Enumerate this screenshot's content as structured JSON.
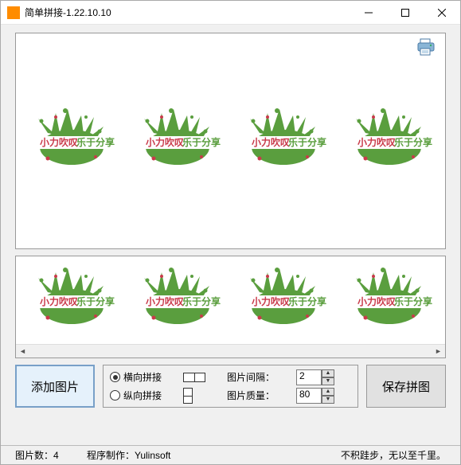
{
  "window": {
    "title": "简单拼接-1.22.10.10"
  },
  "controls": {
    "add_button": "添加图片",
    "save_button": "保存拼图",
    "radio_horizontal": "横向拼接",
    "radio_vertical": "纵向拼接",
    "gap_label": "图片间隔：",
    "quality_label": "图片质量：",
    "gap_value": "2",
    "quality_value": "80"
  },
  "status": {
    "count_label": "图片数：",
    "count_value": "4",
    "author": "程序制作：Yulinsoft",
    "motto": "不积跬步，无以至千里。"
  },
  "splash": {
    "text1": "小力吹叹",
    "text2": "乐于分享"
  }
}
